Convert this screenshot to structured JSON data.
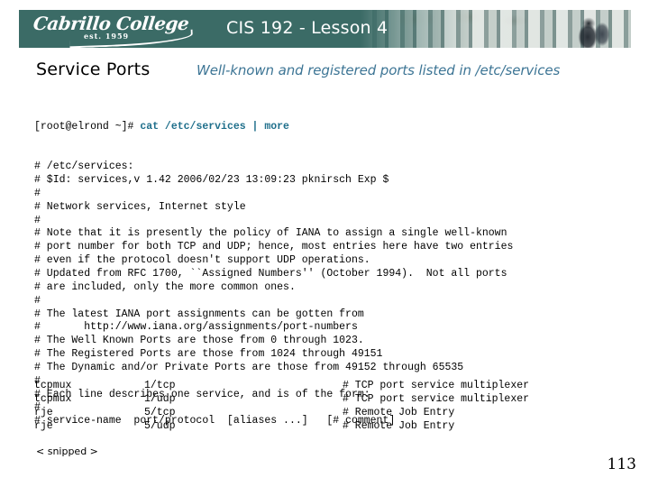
{
  "banner": {
    "logo_word": "Cabrillo College",
    "logo_est": "est. 1959",
    "title": "CIS 192 - Lesson 4",
    "bg_color": "#3b6b66"
  },
  "heading": {
    "title": "Service Ports",
    "subtitle": "Well-known and registered ports listed in /etc/services",
    "subtitle_color": "#3d7595"
  },
  "terminal": {
    "prompt": "[root@elrond ~]# ",
    "command": "cat /etc/services | more",
    "command_color": "#1f6f8b",
    "lines": [
      "# /etc/services:",
      "# $Id: services,v 1.42 2006/02/23 13:09:23 pknirsch Exp $",
      "#",
      "# Network services, Internet style",
      "#",
      "# Note that it is presently the policy of IANA to assign a single well-known",
      "# port number for both TCP and UDP; hence, most entries here have two entries",
      "# even if the protocol doesn't support UDP operations.",
      "# Updated from RFC 1700, ``Assigned Numbers'' (October 1994).  Not all ports",
      "# are included, only the more common ones.",
      "#",
      "# The latest IANA port assignments can be gotten from",
      "#       http://www.iana.org/assignments/port-numbers",
      "# The Well Known Ports are those from 0 through 1023.",
      "# The Registered Ports are those from 1024 through 49151",
      "# The Dynamic and/or Private Ports are those from 49152 through 65535",
      "#",
      "# Each line describes one service, and is of the form:",
      "#",
      "# service-name  port/protocol  [aliases ...]   [# comment]"
    ]
  },
  "entries": [
    {
      "name": "tcpmux",
      "port": "1/tcp",
      "comment": "# TCP port service multiplexer"
    },
    {
      "name": "tcpmux",
      "port": "1/udp",
      "comment": "# TCP port service multiplexer"
    },
    {
      "name": "rje",
      "port": "5/tcp",
      "comment": "# Remote Job Entry"
    },
    {
      "name": "rje",
      "port": "5/udp",
      "comment": "# Remote Job Entry"
    }
  ],
  "footer": {
    "snipped": "< snipped >",
    "page_number": "113"
  }
}
